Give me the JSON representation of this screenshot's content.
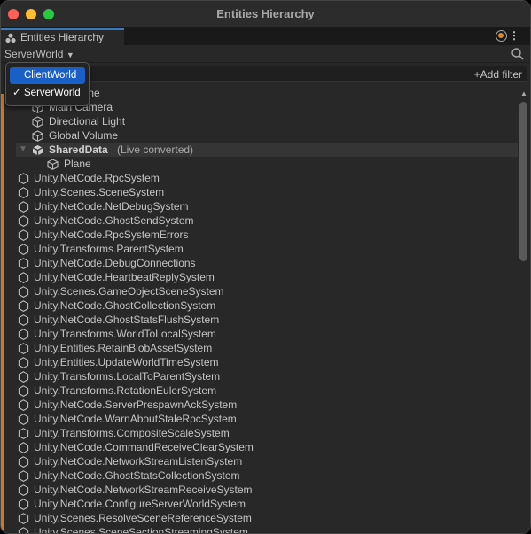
{
  "window": {
    "title": "Entities Hierarchy",
    "traffic_lights": {
      "close": "#fe5f57",
      "minimize": "#febc2e",
      "zoom": "#28c840"
    }
  },
  "tab": {
    "label": "Entities Hierarchy",
    "icon": "entities-icon"
  },
  "toolbar": {
    "world_selected": "ServerWorld",
    "add_filter": "Add filter",
    "live_indicator_color": "#e08a2c"
  },
  "world_dropdown": {
    "options": [
      {
        "label": "ClientWorld",
        "highlighted": true,
        "checked": false
      },
      {
        "label": "ServerWorld",
        "highlighted": false,
        "checked": true
      }
    ]
  },
  "tree": {
    "items": [
      {
        "label": "SampleScene",
        "indent": 0,
        "icon": "scene-icon"
      },
      {
        "label": "Main Camera",
        "indent": 1,
        "icon": "cube-icon"
      },
      {
        "label": "Directional Light",
        "indent": 1,
        "icon": "cube-icon"
      },
      {
        "label": "Global Volume",
        "indent": 1,
        "icon": "cube-icon"
      },
      {
        "label": "SharedData",
        "suffix": "(Live converted)",
        "indent": 1,
        "icon": "subscene-icon",
        "expanded": true,
        "selected": true
      },
      {
        "label": "Plane",
        "indent": 2,
        "icon": "cube-icon"
      },
      {
        "label": "Unity.NetCode.RpcSystem",
        "icon": "system-icon"
      },
      {
        "label": "Unity.Scenes.SceneSystem",
        "icon": "system-icon"
      },
      {
        "label": "Unity.NetCode.NetDebugSystem",
        "icon": "system-icon"
      },
      {
        "label": "Unity.NetCode.GhostSendSystem",
        "icon": "system-icon"
      },
      {
        "label": "Unity.NetCode.RpcSystemErrors",
        "icon": "system-icon"
      },
      {
        "label": "Unity.Transforms.ParentSystem",
        "icon": "system-icon"
      },
      {
        "label": "Unity.NetCode.DebugConnections",
        "icon": "system-icon"
      },
      {
        "label": "Unity.NetCode.HeartbeatReplySystem",
        "icon": "system-icon"
      },
      {
        "label": "Unity.Scenes.GameObjectSceneSystem",
        "icon": "system-icon"
      },
      {
        "label": "Unity.NetCode.GhostCollectionSystem",
        "icon": "system-icon"
      },
      {
        "label": "Unity.NetCode.GhostStatsFlushSystem",
        "icon": "system-icon"
      },
      {
        "label": "Unity.Transforms.WorldToLocalSystem",
        "icon": "system-icon"
      },
      {
        "label": "Unity.Entities.RetainBlobAssetSystem",
        "icon": "system-icon"
      },
      {
        "label": "Unity.Entities.UpdateWorldTimeSystem",
        "icon": "system-icon"
      },
      {
        "label": "Unity.Transforms.LocalToParentSystem",
        "icon": "system-icon"
      },
      {
        "label": "Unity.Transforms.RotationEulerSystem",
        "icon": "system-icon"
      },
      {
        "label": "Unity.NetCode.ServerPrespawnAckSystem",
        "icon": "system-icon"
      },
      {
        "label": "Unity.NetCode.WarnAboutStaleRpcSystem",
        "icon": "system-icon"
      },
      {
        "label": "Unity.Transforms.CompositeScaleSystem",
        "icon": "system-icon"
      },
      {
        "label": "Unity.NetCode.CommandReceiveClearSystem",
        "icon": "system-icon"
      },
      {
        "label": "Unity.NetCode.NetworkStreamListenSystem",
        "icon": "system-icon"
      },
      {
        "label": "Unity.NetCode.GhostStatsCollectionSystem",
        "icon": "system-icon"
      },
      {
        "label": "Unity.NetCode.NetworkStreamReceiveSystem",
        "icon": "system-icon"
      },
      {
        "label": "Unity.NetCode.ConfigureServerWorldSystem",
        "icon": "system-icon"
      },
      {
        "label": "Unity.Scenes.ResolveSceneReferenceSystem",
        "icon": "system-icon"
      },
      {
        "label": "Unity.Scenes.SceneSectionStreamingSystem",
        "icon": "system-icon"
      }
    ]
  }
}
